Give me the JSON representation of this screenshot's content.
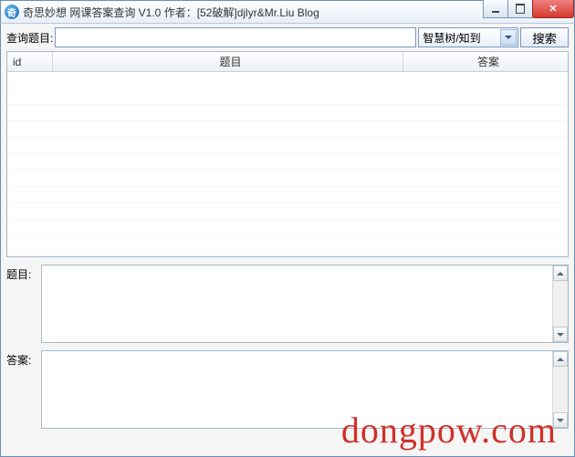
{
  "window": {
    "title": "奇思妙想 网课答案查询 V1.0 作者：[52破解]djlyr&Mr.Liu Blog"
  },
  "search": {
    "label": "查询题目:",
    "value": "",
    "dropdown_selected": "智慧树/知到",
    "button_label": "搜索"
  },
  "table": {
    "columns": {
      "id": "id",
      "question": "题目",
      "answer": "答案"
    },
    "rows": []
  },
  "detail": {
    "question_label": "题目:",
    "question_value": "",
    "answer_label": "答案:",
    "answer_value": ""
  },
  "watermark": "dongpow.com"
}
